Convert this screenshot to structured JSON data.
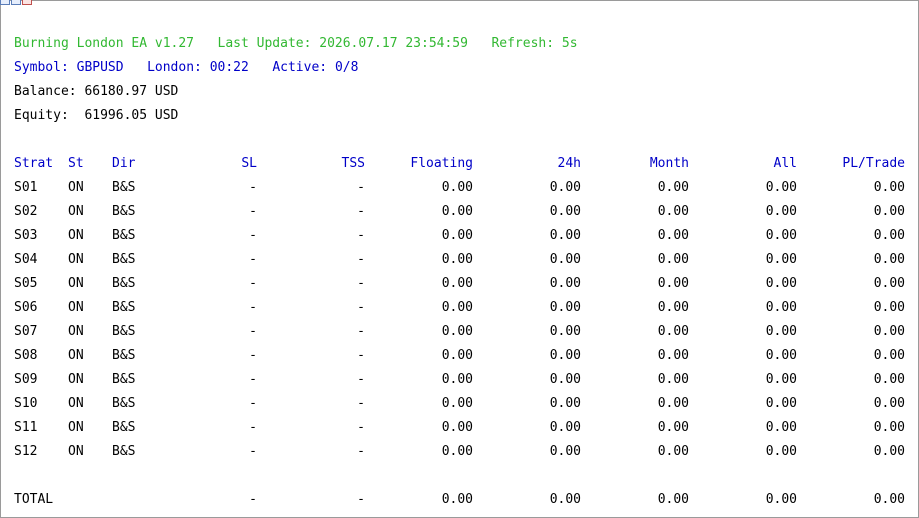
{
  "header": {
    "title": "Burning London EA v1.27",
    "last_update_label": "Last Update:",
    "last_update_value": "2026.07.17 23:54:59",
    "refresh_label": "Refresh:",
    "refresh_value": "5s",
    "symbol_label": "Symbol:",
    "symbol_value": "GBPUSD",
    "london_label": "London:",
    "london_value": "00:22",
    "active_label": "Active:",
    "active_value": "0/8",
    "balance_label": "Balance:",
    "balance_value": "66180.97 USD",
    "equity_label": "Equity:",
    "equity_value": "61996.05 USD"
  },
  "colors": {
    "title_green": "#32b832",
    "info_blue": "#0000c8"
  },
  "table": {
    "columns": [
      "Strat",
      "St",
      "Dir",
      "SL",
      "TSS",
      "Floating",
      "24h",
      "Month",
      "All",
      "PL/Trade"
    ],
    "rows": [
      [
        "S01",
        "ON",
        "B&S",
        "-",
        "-",
        "0.00",
        "0.00",
        "0.00",
        "0.00",
        "0.00"
      ],
      [
        "S02",
        "ON",
        "B&S",
        "-",
        "-",
        "0.00",
        "0.00",
        "0.00",
        "0.00",
        "0.00"
      ],
      [
        "S03",
        "ON",
        "B&S",
        "-",
        "-",
        "0.00",
        "0.00",
        "0.00",
        "0.00",
        "0.00"
      ],
      [
        "S04",
        "ON",
        "B&S",
        "-",
        "-",
        "0.00",
        "0.00",
        "0.00",
        "0.00",
        "0.00"
      ],
      [
        "S05",
        "ON",
        "B&S",
        "-",
        "-",
        "0.00",
        "0.00",
        "0.00",
        "0.00",
        "0.00"
      ],
      [
        "S06",
        "ON",
        "B&S",
        "-",
        "-",
        "0.00",
        "0.00",
        "0.00",
        "0.00",
        "0.00"
      ],
      [
        "S07",
        "ON",
        "B&S",
        "-",
        "-",
        "0.00",
        "0.00",
        "0.00",
        "0.00",
        "0.00"
      ],
      [
        "S08",
        "ON",
        "B&S",
        "-",
        "-",
        "0.00",
        "0.00",
        "0.00",
        "0.00",
        "0.00"
      ],
      [
        "S09",
        "ON",
        "B&S",
        "-",
        "-",
        "0.00",
        "0.00",
        "0.00",
        "0.00",
        "0.00"
      ],
      [
        "S10",
        "ON",
        "B&S",
        "-",
        "-",
        "0.00",
        "0.00",
        "0.00",
        "0.00",
        "0.00"
      ],
      [
        "S11",
        "ON",
        "B&S",
        "-",
        "-",
        "0.00",
        "0.00",
        "0.00",
        "0.00",
        "0.00"
      ],
      [
        "S12",
        "ON",
        "B&S",
        "-",
        "-",
        "0.00",
        "0.00",
        "0.00",
        "0.00",
        "0.00"
      ]
    ],
    "total": [
      "TOTAL",
      "",
      "",
      "-",
      "-",
      "0.00",
      "0.00",
      "0.00",
      "0.00",
      "0.00"
    ]
  }
}
